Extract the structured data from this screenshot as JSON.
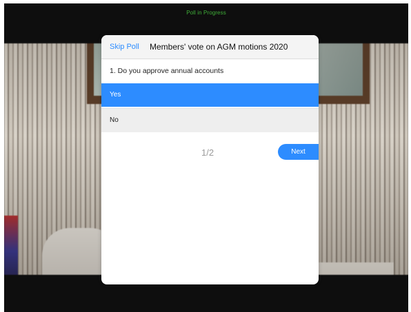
{
  "status_bar": {
    "text": "Poll in Progress"
  },
  "poll": {
    "skip_label": "Skip Poll",
    "title": "Members' vote on AGM motions 2020",
    "question": "1. Do you approve annual accounts",
    "options": [
      {
        "label": "Yes",
        "selected": true
      },
      {
        "label": "No",
        "selected": false
      }
    ],
    "pager": "1/2",
    "next_label": "Next"
  },
  "colors": {
    "accent": "#2d8cff",
    "status_text": "#3fae38",
    "background": "#0e0e0e"
  }
}
